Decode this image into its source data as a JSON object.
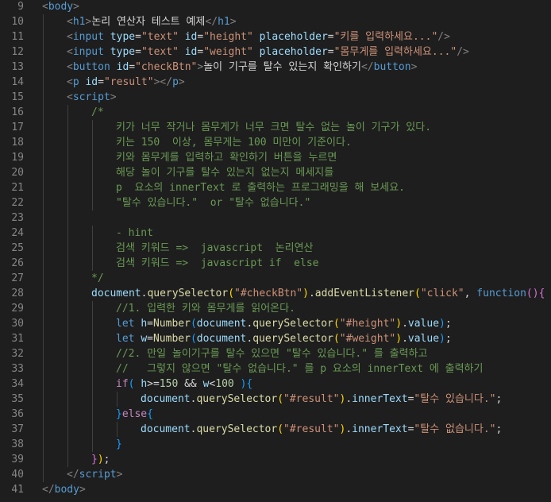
{
  "editor": {
    "colors": {
      "background": "#1e1e1e",
      "line_number": "#858585",
      "tag": "#569cd6",
      "attribute": "#9cdcfe",
      "string": "#ce9178",
      "comment": "#6a9955",
      "function": "#dcdcaa",
      "class": "#4ec9b0",
      "number": "#b5cea8"
    },
    "lines": [
      {
        "n": "9",
        "indent": 0,
        "tokens": [
          {
            "c": "punc",
            "t": "<"
          },
          {
            "c": "tag",
            "t": "body"
          },
          {
            "c": "punc",
            "t": ">"
          }
        ]
      },
      {
        "n": "10",
        "indent": 1,
        "tokens": [
          {
            "c": "punc",
            "t": "<"
          },
          {
            "c": "tag",
            "t": "h1"
          },
          {
            "c": "punc",
            "t": ">"
          },
          {
            "c": "txt",
            "t": "논리 연산자 테스트 예제"
          },
          {
            "c": "punc",
            "t": "</"
          },
          {
            "c": "tag",
            "t": "h1"
          },
          {
            "c": "punc",
            "t": ">"
          }
        ]
      },
      {
        "n": "11",
        "indent": 1,
        "tokens": [
          {
            "c": "punc",
            "t": "<"
          },
          {
            "c": "tag",
            "t": "input"
          },
          {
            "c": "txt",
            "t": " "
          },
          {
            "c": "attr",
            "t": "type"
          },
          {
            "c": "txt",
            "t": "="
          },
          {
            "c": "val",
            "t": "\"text\""
          },
          {
            "c": "txt",
            "t": " "
          },
          {
            "c": "attr",
            "t": "id"
          },
          {
            "c": "txt",
            "t": "="
          },
          {
            "c": "val",
            "t": "\"height\""
          },
          {
            "c": "txt",
            "t": " "
          },
          {
            "c": "attr",
            "t": "placeholder"
          },
          {
            "c": "txt",
            "t": "="
          },
          {
            "c": "val",
            "t": "\"키를 입력하세요...\""
          },
          {
            "c": "punc",
            "t": "/>"
          }
        ]
      },
      {
        "n": "12",
        "indent": 1,
        "tokens": [
          {
            "c": "punc",
            "t": "<"
          },
          {
            "c": "tag",
            "t": "input"
          },
          {
            "c": "txt",
            "t": " "
          },
          {
            "c": "attr",
            "t": "type"
          },
          {
            "c": "txt",
            "t": "="
          },
          {
            "c": "val",
            "t": "\"text\""
          },
          {
            "c": "txt",
            "t": " "
          },
          {
            "c": "attr",
            "t": "id"
          },
          {
            "c": "txt",
            "t": "="
          },
          {
            "c": "val",
            "t": "\"weight\""
          },
          {
            "c": "txt",
            "t": " "
          },
          {
            "c": "attr",
            "t": "placeholder"
          },
          {
            "c": "txt",
            "t": "="
          },
          {
            "c": "val",
            "t": "\"몸무게를 입력하세요...\""
          },
          {
            "c": "punc",
            "t": "/>"
          }
        ]
      },
      {
        "n": "13",
        "indent": 1,
        "tokens": [
          {
            "c": "punc",
            "t": "<"
          },
          {
            "c": "tag",
            "t": "button"
          },
          {
            "c": "txt",
            "t": " "
          },
          {
            "c": "attr",
            "t": "id"
          },
          {
            "c": "txt",
            "t": "="
          },
          {
            "c": "val",
            "t": "\"checkBtn\""
          },
          {
            "c": "punc",
            "t": ">"
          },
          {
            "c": "txt",
            "t": "놀이 기구를 탈수 있는지 확인하기"
          },
          {
            "c": "punc",
            "t": "</"
          },
          {
            "c": "tag",
            "t": "button"
          },
          {
            "c": "punc",
            "t": ">"
          }
        ]
      },
      {
        "n": "14",
        "indent": 1,
        "tokens": [
          {
            "c": "punc",
            "t": "<"
          },
          {
            "c": "tag",
            "t": "p"
          },
          {
            "c": "txt",
            "t": " "
          },
          {
            "c": "attr",
            "t": "id"
          },
          {
            "c": "txt",
            "t": "="
          },
          {
            "c": "val",
            "t": "\"result\""
          },
          {
            "c": "punc",
            "t": "></"
          },
          {
            "c": "tag",
            "t": "p"
          },
          {
            "c": "punc",
            "t": ">"
          }
        ]
      },
      {
        "n": "15",
        "indent": 1,
        "tokens": [
          {
            "c": "punc",
            "t": "<"
          },
          {
            "c": "tag",
            "t": "script"
          },
          {
            "c": "punc",
            "t": ">"
          }
        ]
      },
      {
        "n": "16",
        "indent": 2,
        "tokens": [
          {
            "c": "cm",
            "t": "/*"
          }
        ]
      },
      {
        "n": "17",
        "indent": 3,
        "tokens": [
          {
            "c": "cm",
            "t": "키가 너무 작거나 몸무게가 너무 크면 탈수 없는 놀이 기구가 있다."
          }
        ]
      },
      {
        "n": "18",
        "indent": 3,
        "tokens": [
          {
            "c": "cm",
            "t": "키는 150  이상, 몸무게는 100 미만이 기준이다."
          }
        ]
      },
      {
        "n": "19",
        "indent": 3,
        "tokens": [
          {
            "c": "cm",
            "t": "키와 몸무게를 입력하고 확인하기 버튼을 누르면"
          }
        ]
      },
      {
        "n": "20",
        "indent": 3,
        "tokens": [
          {
            "c": "cm",
            "t": "해당 놀이 기구를 탈수 있는지 없는지 메세지를"
          }
        ]
      },
      {
        "n": "21",
        "indent": 3,
        "tokens": [
          {
            "c": "cm",
            "t": "p  요소의 innerText 로 출력하는 프로그래밍을 해 보세요."
          }
        ]
      },
      {
        "n": "22",
        "indent": 3,
        "tokens": [
          {
            "c": "cm",
            "t": "\"탈수 있습니다.\"  or \"탈수 없습니다.\""
          }
        ]
      },
      {
        "n": "23",
        "indent": 2,
        "tokens": []
      },
      {
        "n": "24",
        "indent": 3,
        "tokens": [
          {
            "c": "cm",
            "t": "- hint"
          }
        ]
      },
      {
        "n": "25",
        "indent": 3,
        "tokens": [
          {
            "c": "cm",
            "t": "검색 키워드 =>  javascript  논리연산"
          }
        ]
      },
      {
        "n": "26",
        "indent": 3,
        "tokens": [
          {
            "c": "cm",
            "t": "검색 키워드 =>  javascript if  else"
          }
        ]
      },
      {
        "n": "27",
        "indent": 2,
        "tokens": [
          {
            "c": "cm",
            "t": "*/"
          }
        ]
      },
      {
        "n": "28",
        "indent": 2,
        "tokens": [
          {
            "c": "var",
            "t": "document"
          },
          {
            "c": "op",
            "t": "."
          },
          {
            "c": "fn",
            "t": "querySelector"
          },
          {
            "c": "b1",
            "t": "("
          },
          {
            "c": "str",
            "t": "\"#checkBtn\""
          },
          {
            "c": "b1",
            "t": ")"
          },
          {
            "c": "op",
            "t": "."
          },
          {
            "c": "fn",
            "t": "addEventListener"
          },
          {
            "c": "b1",
            "t": "("
          },
          {
            "c": "str",
            "t": "\"click\""
          },
          {
            "c": "op",
            "t": ", "
          },
          {
            "c": "kw",
            "t": "function"
          },
          {
            "c": "b2",
            "t": "()"
          },
          {
            "c": "b2",
            "t": "{"
          }
        ]
      },
      {
        "n": "29",
        "indent": 3,
        "tokens": [
          {
            "c": "cm",
            "t": "//1. 입력한 키와 몸무게를 읽어온다."
          }
        ]
      },
      {
        "n": "30",
        "indent": 3,
        "tokens": [
          {
            "c": "kw",
            "t": "let"
          },
          {
            "c": "op",
            "t": " "
          },
          {
            "c": "var",
            "t": "h"
          },
          {
            "c": "op",
            "t": "="
          },
          {
            "c": "fn",
            "t": "Number"
          },
          {
            "c": "b3",
            "t": "("
          },
          {
            "c": "var",
            "t": "document"
          },
          {
            "c": "op",
            "t": "."
          },
          {
            "c": "fn",
            "t": "querySelector"
          },
          {
            "c": "b1",
            "t": "("
          },
          {
            "c": "str",
            "t": "\"#height\""
          },
          {
            "c": "b1",
            "t": ")"
          },
          {
            "c": "op",
            "t": "."
          },
          {
            "c": "var",
            "t": "value"
          },
          {
            "c": "b3",
            "t": ")"
          },
          {
            "c": "op",
            "t": ";"
          }
        ]
      },
      {
        "n": "31",
        "indent": 3,
        "tokens": [
          {
            "c": "kw",
            "t": "let"
          },
          {
            "c": "op",
            "t": " "
          },
          {
            "c": "var",
            "t": "w"
          },
          {
            "c": "op",
            "t": "="
          },
          {
            "c": "fn",
            "t": "Number"
          },
          {
            "c": "b3",
            "t": "("
          },
          {
            "c": "var",
            "t": "document"
          },
          {
            "c": "op",
            "t": "."
          },
          {
            "c": "fn",
            "t": "querySelector"
          },
          {
            "c": "b1",
            "t": "("
          },
          {
            "c": "str",
            "t": "\"#weight\""
          },
          {
            "c": "b1",
            "t": ")"
          },
          {
            "c": "op",
            "t": "."
          },
          {
            "c": "var",
            "t": "value"
          },
          {
            "c": "b3",
            "t": ")"
          },
          {
            "c": "op",
            "t": ";"
          }
        ]
      },
      {
        "n": "32",
        "indent": 3,
        "tokens": [
          {
            "c": "cm",
            "t": "//2. 만일 놀이기구를 탈수 있으면 \"탈수 있습니다.\" 를 출력하고"
          }
        ]
      },
      {
        "n": "33",
        "indent": 3,
        "tokens": [
          {
            "c": "cm",
            "t": "//   그렇지 않으면 \"탈수 없습니다.\" 를 p 요소의 innerText 에 출력하기"
          }
        ]
      },
      {
        "n": "34",
        "indent": 3,
        "tokens": [
          {
            "c": "ctl",
            "t": "if"
          },
          {
            "c": "b3",
            "t": "("
          },
          {
            "c": "op",
            "t": " "
          },
          {
            "c": "var",
            "t": "h"
          },
          {
            "c": "op",
            "t": ">="
          },
          {
            "c": "num",
            "t": "150"
          },
          {
            "c": "op",
            "t": " && "
          },
          {
            "c": "var",
            "t": "w"
          },
          {
            "c": "op",
            "t": "<"
          },
          {
            "c": "num",
            "t": "100"
          },
          {
            "c": "op",
            "t": " "
          },
          {
            "c": "b3",
            "t": ")"
          },
          {
            "c": "b3",
            "t": "{"
          }
        ]
      },
      {
        "n": "35",
        "indent": 4,
        "tokens": [
          {
            "c": "var",
            "t": "document"
          },
          {
            "c": "op",
            "t": "."
          },
          {
            "c": "fn",
            "t": "querySelector"
          },
          {
            "c": "b1",
            "t": "("
          },
          {
            "c": "str",
            "t": "\"#result\""
          },
          {
            "c": "b1",
            "t": ")"
          },
          {
            "c": "op",
            "t": "."
          },
          {
            "c": "var",
            "t": "innerText"
          },
          {
            "c": "op",
            "t": "="
          },
          {
            "c": "str",
            "t": "\"탈수 있습니다.\""
          },
          {
            "c": "op",
            "t": ";"
          }
        ]
      },
      {
        "n": "36",
        "indent": 3,
        "tokens": [
          {
            "c": "b3",
            "t": "}"
          },
          {
            "c": "ctl",
            "t": "else"
          },
          {
            "c": "b3",
            "t": "{"
          }
        ]
      },
      {
        "n": "37",
        "indent": 4,
        "tokens": [
          {
            "c": "var",
            "t": "document"
          },
          {
            "c": "op",
            "t": "."
          },
          {
            "c": "fn",
            "t": "querySelector"
          },
          {
            "c": "b1",
            "t": "("
          },
          {
            "c": "str",
            "t": "\"#result\""
          },
          {
            "c": "b1",
            "t": ")"
          },
          {
            "c": "op",
            "t": "."
          },
          {
            "c": "var",
            "t": "innerText"
          },
          {
            "c": "op",
            "t": "="
          },
          {
            "c": "str",
            "t": "\"탈수 없습니다.\""
          },
          {
            "c": "op",
            "t": ";"
          }
        ]
      },
      {
        "n": "38",
        "indent": 3,
        "tokens": [
          {
            "c": "b3",
            "t": "}"
          }
        ]
      },
      {
        "n": "39",
        "indent": 2,
        "tokens": [
          {
            "c": "b2",
            "t": "}"
          },
          {
            "c": "b1",
            "t": ")"
          },
          {
            "c": "op",
            "t": ";"
          }
        ]
      },
      {
        "n": "40",
        "indent": 1,
        "tokens": [
          {
            "c": "punc",
            "t": "</"
          },
          {
            "c": "tag",
            "t": "script"
          },
          {
            "c": "punc",
            "t": ">"
          }
        ]
      },
      {
        "n": "41",
        "indent": 0,
        "tokens": [
          {
            "c": "punc",
            "t": "</"
          },
          {
            "c": "tag",
            "t": "body"
          },
          {
            "c": "punc",
            "t": ">"
          }
        ]
      }
    ]
  }
}
